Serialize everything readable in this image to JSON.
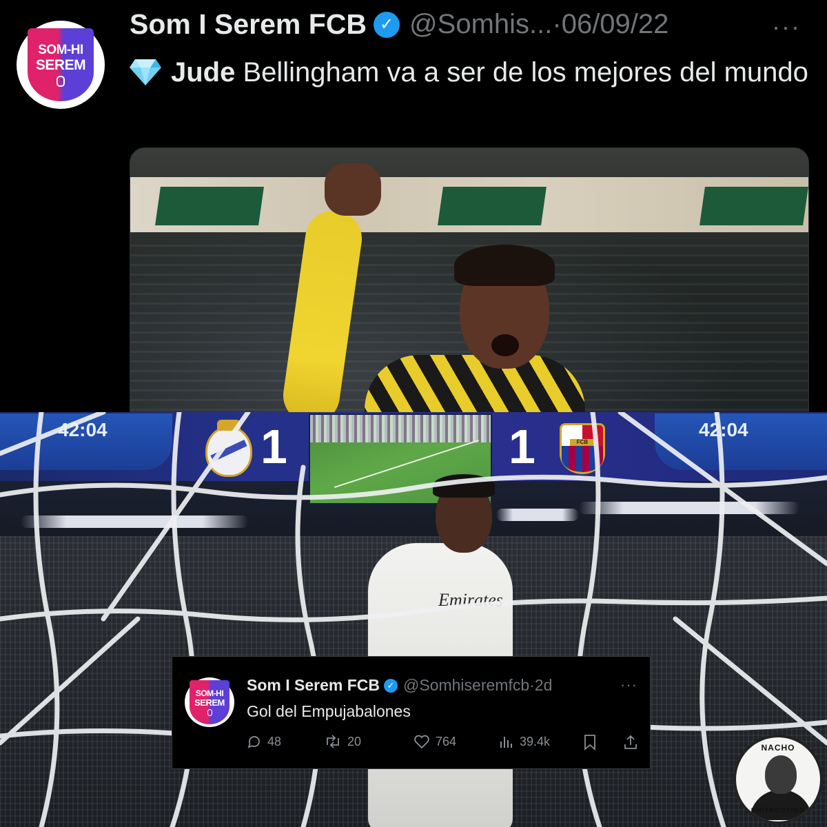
{
  "top_tweet": {
    "avatar_lines": [
      "SOM-HI",
      "SEREM"
    ],
    "display_name": "Som I Serem FCB",
    "handle": "@Somhis...",
    "separator": "·",
    "date": "06/09/22",
    "more_icon": "more-dots-icon",
    "text_bold": "Jude",
    "text_rest": " Bellingham va a ser de los mejores del mundo",
    "emoji_icon": "gem-icon"
  },
  "scoreboard": {
    "clock_left": "42:04",
    "clock_right": "42:04",
    "home_score": "1",
    "away_score": "1",
    "fcb_label": "FCB"
  },
  "jersey_sponsor": "Emirates",
  "embedded_tweet": {
    "avatar_lines": [
      "SOM-HI",
      "SEREM"
    ],
    "display_name": "Som I Serem FCB",
    "handle": "@Somhiseremfcb",
    "separator": "·",
    "time": "2d",
    "text": "Gol del Empujabalones",
    "replies": "48",
    "retweets": "20",
    "likes": "764",
    "views": "39.4k"
  },
  "watermark": {
    "top": "NACHO",
    "bottom": "SHITPOSTING"
  },
  "colors": {
    "background": "#000000",
    "text_primary": "#e7e9ea",
    "text_secondary": "#71767b",
    "verified_blue": "#1d9bf0",
    "crest_pink": "#e0226b",
    "crest_purple": "#5b3fd6"
  }
}
